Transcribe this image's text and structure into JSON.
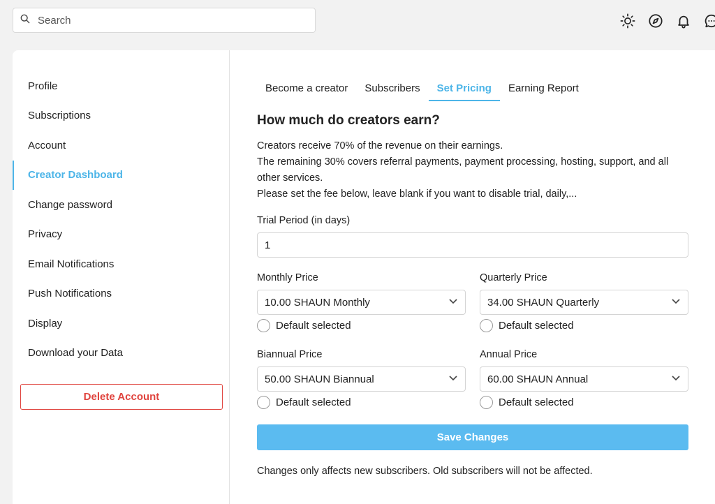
{
  "search": {
    "placeholder": "Search"
  },
  "top_icons": [
    "sun-icon",
    "compass-icon",
    "bell-icon",
    "chat-icon"
  ],
  "sidebar": {
    "items": [
      {
        "label": "Profile"
      },
      {
        "label": "Subscriptions"
      },
      {
        "label": "Account"
      },
      {
        "label": "Creator Dashboard",
        "active": true
      },
      {
        "label": "Change password"
      },
      {
        "label": "Privacy"
      },
      {
        "label": "Email Notifications"
      },
      {
        "label": "Push Notifications"
      },
      {
        "label": "Display"
      },
      {
        "label": "Download your Data"
      }
    ],
    "delete_label": "Delete Account"
  },
  "tabs": [
    {
      "label": "Become a creator"
    },
    {
      "label": "Subscribers"
    },
    {
      "label": "Set Pricing",
      "active": true
    },
    {
      "label": "Earning Report"
    }
  ],
  "main": {
    "heading": "How much do creators earn?",
    "desc_lines": [
      "Creators receive 70% of the revenue on their earnings.",
      "The remaining 30% covers referral payments, payment processing, hosting, support, and all other services.",
      "Please set the fee below, leave blank if you want to disable trial, daily,..."
    ],
    "trial": {
      "label": "Trial Period (in days)",
      "value": "1"
    },
    "monthly": {
      "label": "Monthly Price",
      "value": "10.00 SHAUN Monthly",
      "default_label": "Default selected"
    },
    "quarterly": {
      "label": "Quarterly Price",
      "value": "34.00 SHAUN Quarterly",
      "default_label": "Default selected"
    },
    "biannual": {
      "label": "Biannual Price",
      "value": "50.00 SHAUN Biannual",
      "default_label": "Default selected"
    },
    "annual": {
      "label": "Annual Price",
      "value": "60.00 SHAUN Annual",
      "default_label": "Default selected"
    },
    "save_label": "Save Changes",
    "footnote": "Changes only affects new subscribers. Old subscribers will not be affected."
  },
  "colors": {
    "accent": "#4db5e8",
    "danger": "#e0453f",
    "save_bg": "#5bbbf0"
  }
}
